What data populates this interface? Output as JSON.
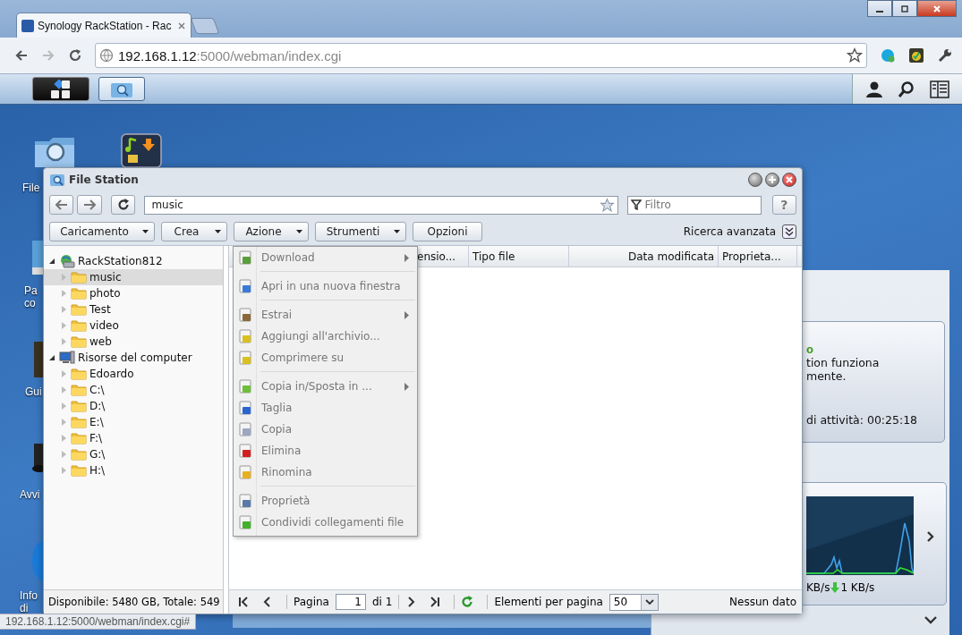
{
  "browser": {
    "tab_title": "Synology RackStation - Rac",
    "url_host": "192.168.1.12",
    "url_path": ":5000/webman/index.cgi",
    "status_url": "192.168.1.12:5000/webman/index.cgi#"
  },
  "desktop_icons": [
    {
      "lines": [
        "File"
      ]
    },
    {
      "lines": [
        "Pa",
        "co"
      ]
    },
    {
      "lines": [
        "Gui"
      ]
    },
    {
      "lines": [
        "Avvi"
      ]
    },
    {
      "lines": [
        "Info",
        "di"
      ]
    }
  ],
  "file_station": {
    "title": "File Station",
    "path": "music",
    "filter_placeholder": "Filtro",
    "help": "?",
    "toolbar": [
      {
        "label": "Caricamento",
        "dropdown": true
      },
      {
        "label": "Crea",
        "dropdown": true
      },
      {
        "label": "Azione",
        "dropdown": true
      },
      {
        "label": "Strumenti",
        "dropdown": true
      },
      {
        "label": "Opzioni",
        "dropdown": false
      }
    ],
    "advanced_search": "Ricerca avanzata",
    "tree": [
      {
        "label": "RackStation812",
        "kind": "server",
        "expanded": true,
        "children": [
          {
            "label": "music",
            "selected": true,
            "expanded": false
          },
          {
            "label": "photo",
            "selected": false,
            "expanded": false
          },
          {
            "label": "Test",
            "selected": false,
            "expanded": false
          },
          {
            "label": "video",
            "selected": false,
            "expanded": false
          },
          {
            "label": "web",
            "selected": false,
            "expanded": false
          }
        ]
      },
      {
        "label": "Risorse del computer",
        "kind": "computer",
        "expanded": true,
        "children": [
          {
            "label": "Edoardo",
            "selected": false,
            "expanded": false
          },
          {
            "label": "C:\\",
            "selected": false,
            "expanded": false
          },
          {
            "label": "D:\\",
            "selected": false,
            "expanded": false
          },
          {
            "label": "E:\\",
            "selected": false,
            "expanded": false
          },
          {
            "label": "F:\\",
            "selected": false,
            "expanded": false
          },
          {
            "label": "G:\\",
            "selected": false,
            "expanded": false
          },
          {
            "label": "H:\\",
            "selected": false,
            "expanded": false
          }
        ]
      }
    ],
    "free_space": "Disponibile: 5480 GB, Totale: 549",
    "columns": [
      "ensio...",
      "Tipo file",
      "Data modificata",
      "Proprieta..."
    ],
    "pager": {
      "page_label": "Pagina",
      "page": "1",
      "page_total": "di 1",
      "per_page_label": "Elementi per pagina",
      "per_page": "50",
      "status": "Nessun dato"
    },
    "menu": [
      {
        "kind": "item",
        "label": "Download",
        "submenu": true,
        "disabled": true
      },
      {
        "kind": "separator"
      },
      {
        "kind": "item",
        "label": "Apri in una nuova finestra",
        "submenu": false,
        "disabled": true
      },
      {
        "kind": "separator"
      },
      {
        "kind": "item",
        "label": "Estrai",
        "submenu": true,
        "disabled": true
      },
      {
        "kind": "item",
        "label": "Aggiungi all'archivio...",
        "submenu": false,
        "disabled": true
      },
      {
        "kind": "item",
        "label": "Comprimere su",
        "submenu": false,
        "disabled": true
      },
      {
        "kind": "separator"
      },
      {
        "kind": "item",
        "label": "Copia in/Sposta in ...",
        "submenu": true,
        "disabled": true
      },
      {
        "kind": "item",
        "label": "Taglia",
        "submenu": false,
        "disabled": true
      },
      {
        "kind": "item",
        "label": "Copia",
        "submenu": false,
        "disabled": true
      },
      {
        "kind": "item",
        "label": "Elimina",
        "submenu": false,
        "disabled": true
      },
      {
        "kind": "item",
        "label": "Rinomina",
        "submenu": false,
        "disabled": true
      },
      {
        "kind": "separator"
      },
      {
        "kind": "item",
        "label": "Proprietà",
        "submenu": false,
        "disabled": true
      },
      {
        "kind": "item",
        "label": "Condividi collegamenti file",
        "submenu": false,
        "disabled": true
      }
    ]
  },
  "widgets": {
    "status": {
      "heading_tail": "o",
      "lines": [
        "tion funziona",
        "mente."
      ],
      "uptime": "di attività: 00:25:18"
    },
    "network": {
      "upload": "KB/s",
      "download": "1 KB/s"
    }
  }
}
